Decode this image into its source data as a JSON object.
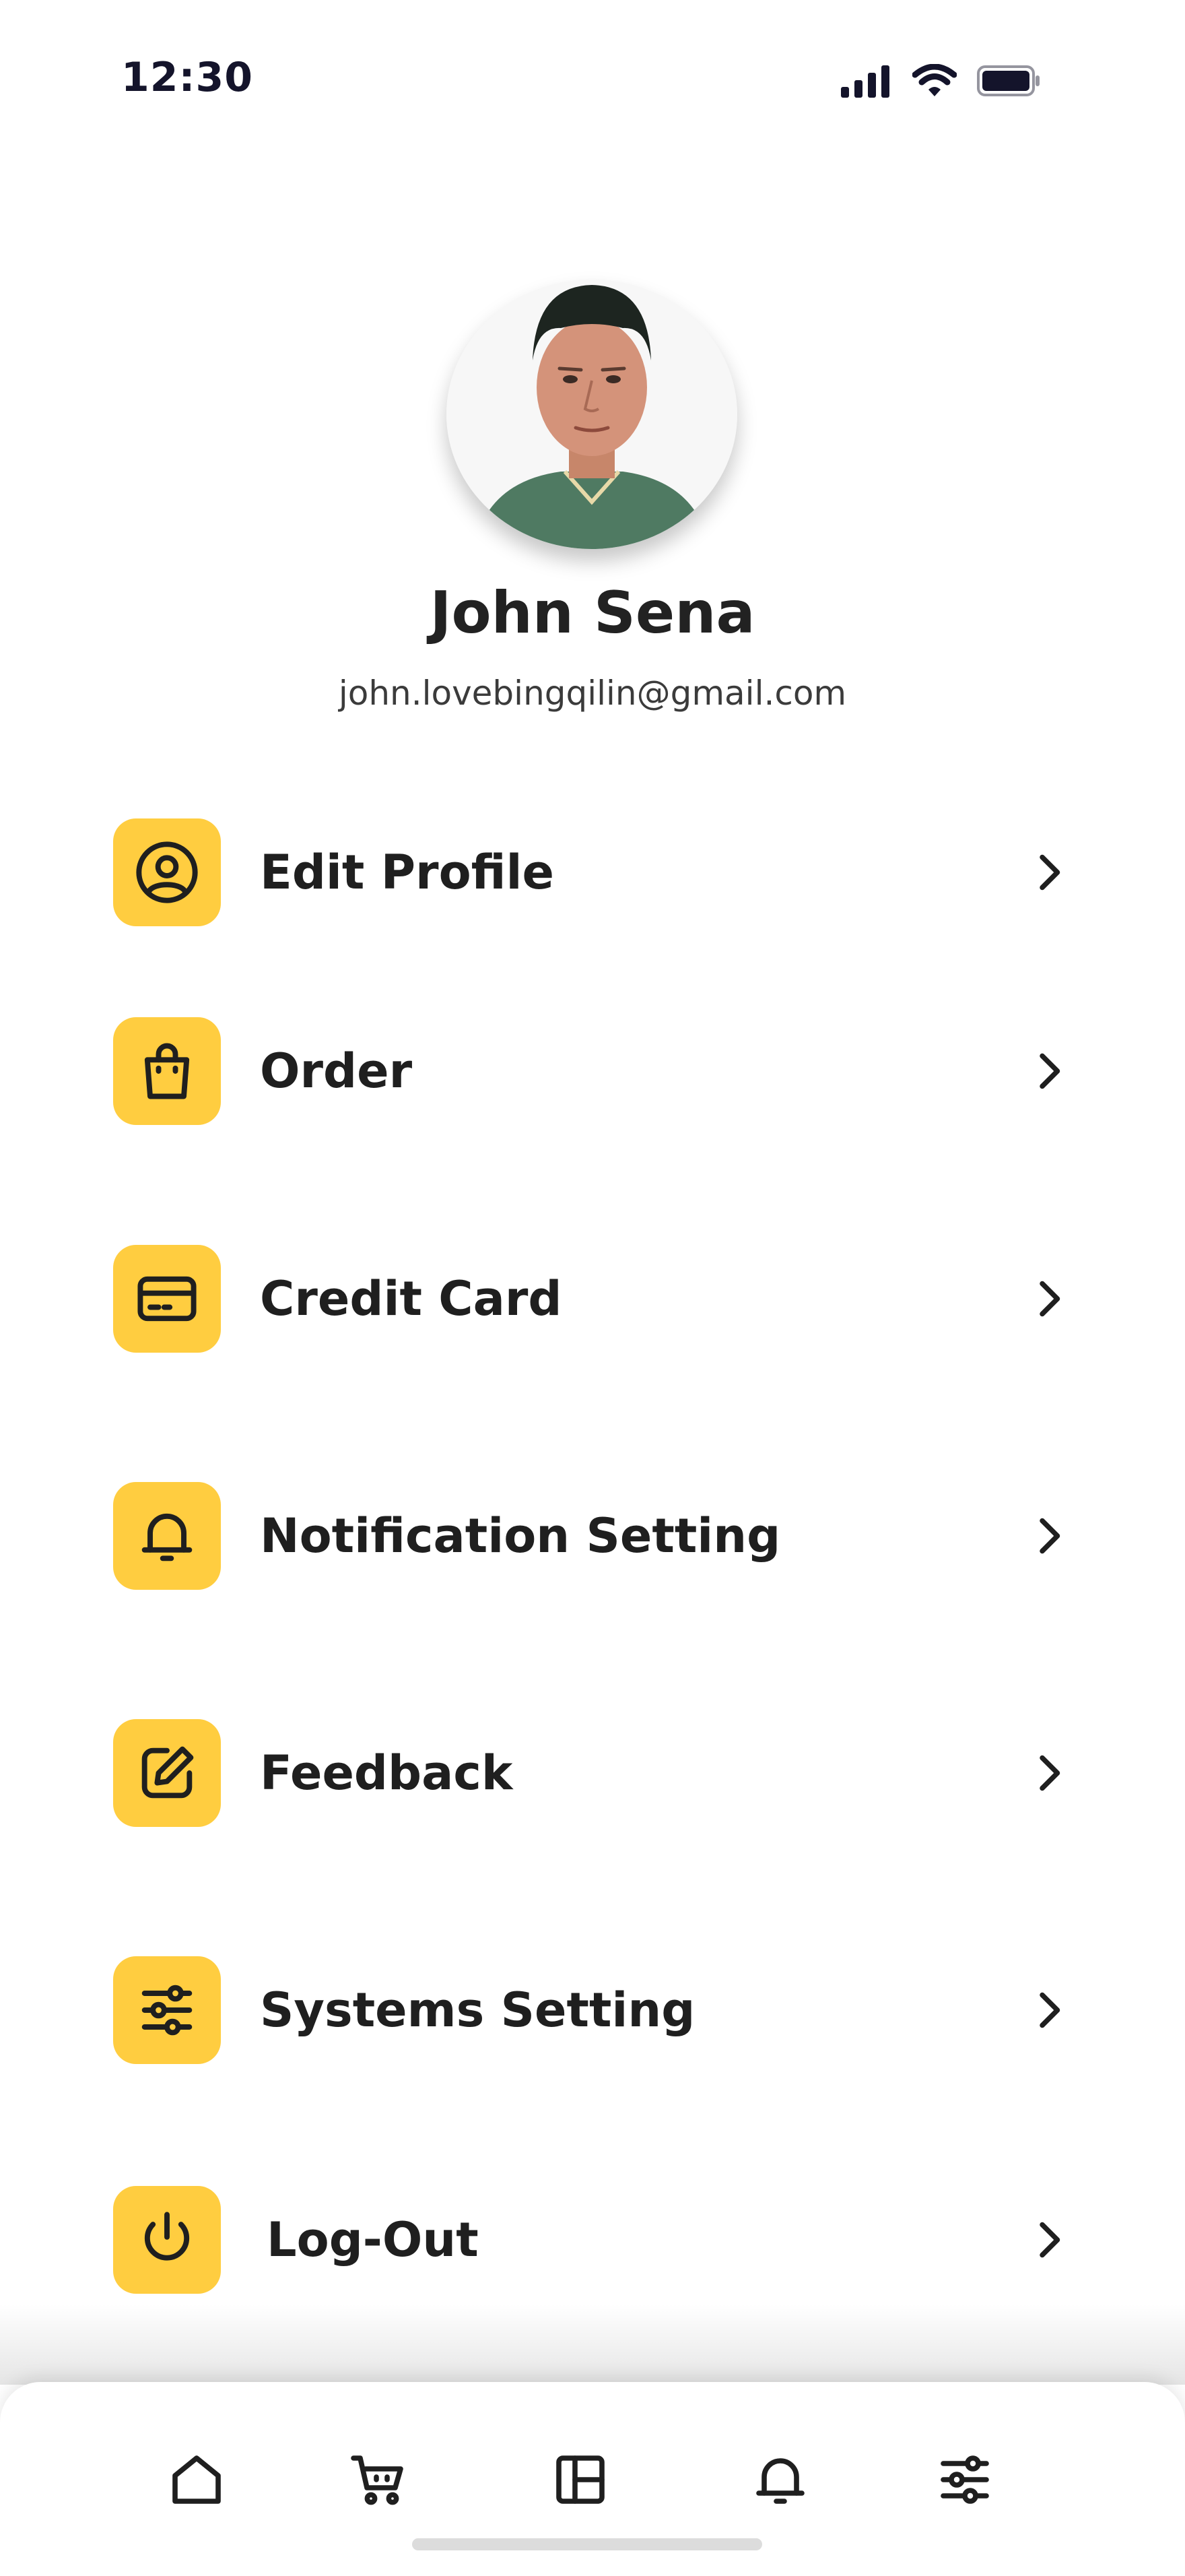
{
  "status_bar": {
    "time": "12:30",
    "icons": [
      "signal-icon",
      "wifi-icon",
      "battery-icon"
    ]
  },
  "profile": {
    "name": "John Sena",
    "email": "john.lovebingqilin@gmail.com"
  },
  "menu": {
    "items": [
      {
        "label": "Edit Profile",
        "icon": "user-circle-icon"
      },
      {
        "label": "Order",
        "icon": "shopping-bag-icon"
      },
      {
        "label": "Credit Card",
        "icon": "credit-card-icon"
      },
      {
        "label": "Notification Setting",
        "icon": "bell-icon"
      },
      {
        "label": "Feedback",
        "icon": "edit-icon"
      },
      {
        "label": "Systems Setting",
        "icon": "sliders-icon"
      },
      {
        "label": "Log-Out",
        "icon": "power-icon"
      }
    ]
  },
  "tab_bar": {
    "tabs": [
      "home-icon",
      "cart-icon",
      "layout-icon",
      "bell-icon",
      "sliders-icon"
    ]
  },
  "colors": {
    "accent": "#ffcd40",
    "text": "#1f1f1f",
    "background": "#ffffff"
  }
}
